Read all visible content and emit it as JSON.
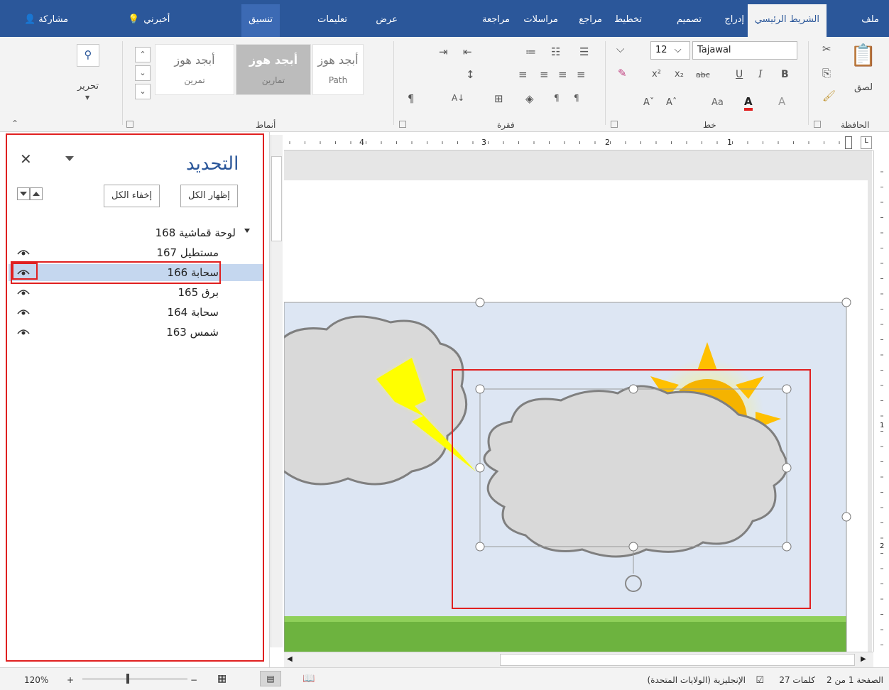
{
  "tabs": {
    "file": "ملف",
    "home": "الشريط الرئيسي",
    "insert": "إدراج",
    "design": "تصميم",
    "layout": "تخطيط",
    "references": "مراجع",
    "mailings": "مراسلات",
    "review": "مراجعة",
    "view": "عرض",
    "help": "تعليمات",
    "format": "تنسيق",
    "tell_me": "أخبرني",
    "share": "مشاركة"
  },
  "ribbon": {
    "clipboard": {
      "label": "الحافظة",
      "paste": "لصق"
    },
    "font": {
      "label": "خط",
      "name": "Tajawal",
      "size": "12",
      "change_case": "Aa"
    },
    "paragraph": {
      "label": "فقرة"
    },
    "styles": {
      "label": "أنماط",
      "items": [
        {
          "preview": "أبجد هوز",
          "name": "Path"
        },
        {
          "preview": "أبجد هوز",
          "name": "تمارين"
        },
        {
          "preview": "أبجد هوز",
          "name": "تمرين"
        }
      ]
    },
    "editing": {
      "label": "تحرير"
    }
  },
  "selection_pane": {
    "title": "التحديد",
    "show_all": "إظهار الكل",
    "hide_all": "إخفاء الكل",
    "items": [
      {
        "label": "لوحة قماشية 168",
        "group": true,
        "selected": false
      },
      {
        "label": "مستطيل 167",
        "group": false,
        "selected": false
      },
      {
        "label": "سحابة 166",
        "group": false,
        "selected": true
      },
      {
        "label": "برق 165",
        "group": false,
        "selected": false
      },
      {
        "label": "سحابة 164",
        "group": false,
        "selected": false
      },
      {
        "label": "شمس 163",
        "group": false,
        "selected": false
      }
    ]
  },
  "ruler": {
    "numbers": [
      "4",
      "3",
      "2",
      "1"
    ]
  },
  "vruler": {
    "numbers": [
      "1",
      "2"
    ]
  },
  "status": {
    "page": "الصفحة 1 من 2",
    "words": "27 كلمات",
    "language": "الإنجليزية (الولايات المتحدة)",
    "zoom": "120%"
  },
  "colors": {
    "accent": "#2b579a",
    "selected_row": "#c5d7ef",
    "highlight": "#e02020",
    "canvas": "#dde6f3",
    "ground": "#6db33f"
  }
}
